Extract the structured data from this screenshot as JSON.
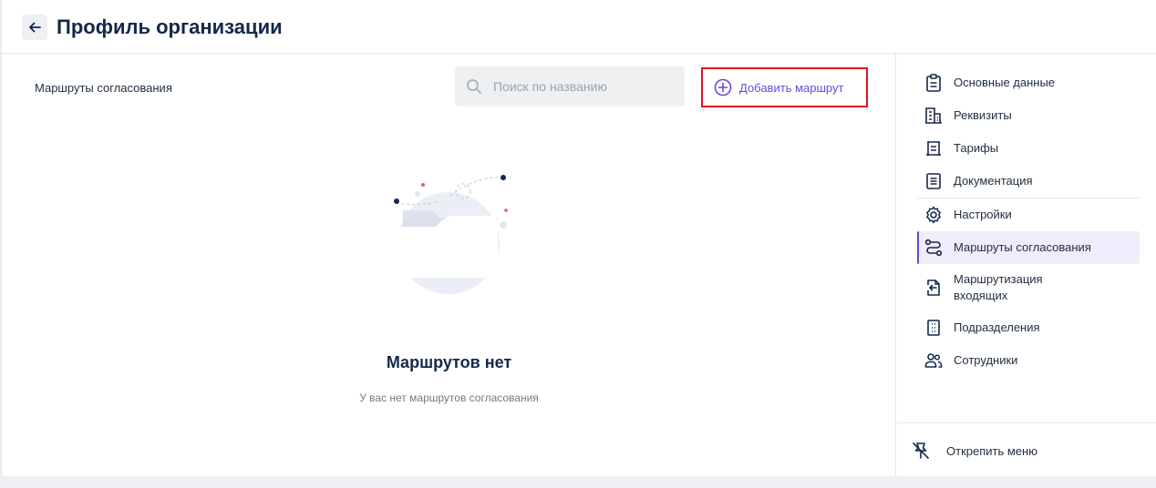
{
  "header": {
    "title": "Профиль организации"
  },
  "main": {
    "section_title": "Маршруты согласования",
    "search": {
      "placeholder": "Поиск по названию",
      "value": ""
    },
    "add_button_label": "Добавить маршрут",
    "empty_title": "Маршрутов нет",
    "empty_subtitle": "У вас нет маршрутов согласования"
  },
  "sidebar": {
    "items": [
      {
        "label": "Основные данные",
        "icon": "clipboard-icon"
      },
      {
        "label": "Реквизиты",
        "icon": "building-icon"
      },
      {
        "label": "Тарифы",
        "icon": "tariff-icon"
      },
      {
        "label": "Документация",
        "icon": "document-icon"
      },
      {
        "label": "Настройки",
        "icon": "gear-icon"
      },
      {
        "label": "Маршруты согласования",
        "icon": "route-icon",
        "active": true
      },
      {
        "label_line1": "Маршрутизация",
        "label_line2": "входящих",
        "icon": "incoming-icon"
      },
      {
        "label": "Подразделения",
        "icon": "departments-icon"
      },
      {
        "label": "Сотрудники",
        "icon": "employees-icon"
      }
    ],
    "unpin_label": "Открепить меню"
  },
  "colors": {
    "accent": "#6b48d8",
    "active_bg": "#efecfb",
    "title": "#14284b",
    "highlight_border": "#e0141e"
  }
}
